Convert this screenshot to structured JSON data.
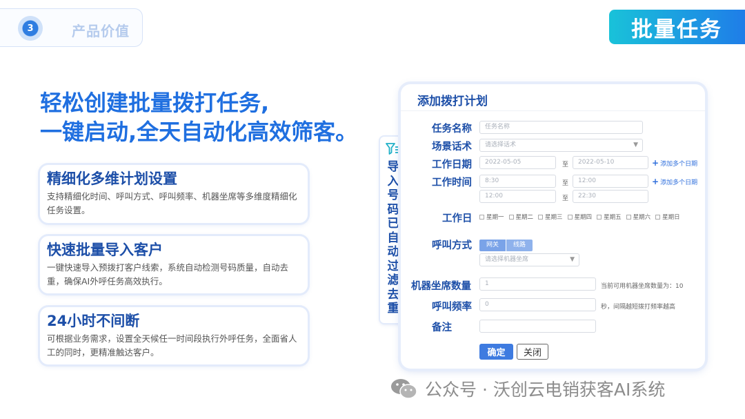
{
  "section": {
    "number": "3",
    "title": "产品价值"
  },
  "top_tag": "批量任务",
  "headline": {
    "line1": "轻松创建批量拨打任务,",
    "line2": "一键启动,全天自动化高效筛客。"
  },
  "features": [
    {
      "title": "精细化多维计划设置",
      "desc": "支持精细化时间、呼叫方式、呼叫频率、机器坐席等多维度精细化任务设置。"
    },
    {
      "title": "快速批量导入客户",
      "desc": "一键快速导入预拨打客户线索，系统自动检测号码质量，自动去重，确保AI外呼任务高效执行。"
    },
    {
      "title": "24小时不间断",
      "desc": "可根据业务需求，设置全天候任一时间段执行外呼任务，全面省人工的同时，更精准触达客户。"
    }
  ],
  "import_strip": {
    "chars": [
      "导",
      "入",
      "号",
      "码",
      "已",
      "自",
      "动",
      "过",
      "滤",
      "去",
      "重"
    ]
  },
  "dialog": {
    "title": "添加拨打计划",
    "task_name": {
      "label": "任务名称",
      "placeholder": "任务名称"
    },
    "script": {
      "label": "场景话术",
      "placeholder": "请选择话术"
    },
    "work_date": {
      "label": "工作日期",
      "start": "2022-05-05",
      "to": "至",
      "end": "2022-05-10",
      "add": "添加多个日期"
    },
    "work_time": {
      "label": "工作时间",
      "row1_start": "8:30",
      "row1_end": "12:00",
      "row2_start": "12:00",
      "row2_end": "22:30",
      "to": "至",
      "add": "添加多个日期"
    },
    "workday": {
      "label": "工作日",
      "days": [
        "星期一",
        "星期二",
        "星期三",
        "星期四",
        "星期五",
        "星期六",
        "星期日"
      ]
    },
    "call_mode": {
      "label": "呼叫方式",
      "options": [
        "网关",
        "线路"
      ],
      "select_placeholder": "请选择机器坐席"
    },
    "seats": {
      "label": "机器坐席数量",
      "value": "1",
      "hint": "当前可用机器坐席数量为：10"
    },
    "frequency": {
      "label": "呼叫频率",
      "value": "0",
      "hint": "秒，间隔越短拨打频率越高"
    },
    "remark": {
      "label": "备注",
      "value": ""
    },
    "confirm": "确定",
    "close": "关闭"
  },
  "watermark": "公众号 · 沃创云电销获客AI系统",
  "colors": {
    "primary": "#1f6fe0",
    "dark_blue": "#1d4fa8",
    "tag_gradient_start": "#19c2d9",
    "tag_gradient_end": "#1f7de8"
  }
}
